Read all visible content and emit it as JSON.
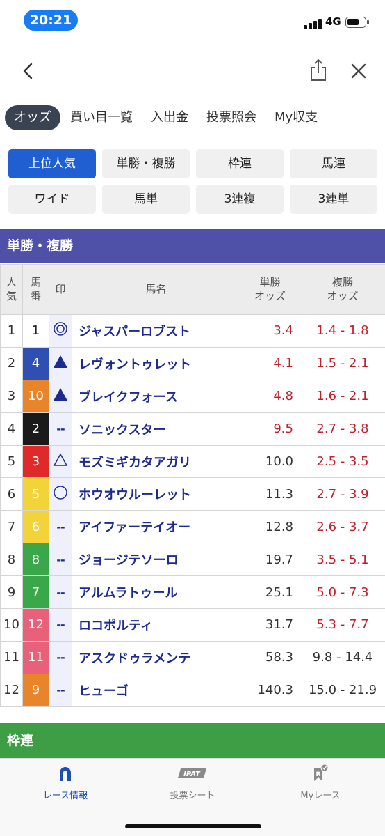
{
  "status": {
    "time": "20:21",
    "network": "4G"
  },
  "tabs": [
    "オッズ",
    "買い目一覧",
    "入出金",
    "投票照会",
    "My収支"
  ],
  "bet_types": [
    "上位人気",
    "単勝・複勝",
    "枠連",
    "馬連",
    "ワイド",
    "馬単",
    "3連複",
    "3連単"
  ],
  "section_title": "単勝・複勝",
  "table": {
    "headers": {
      "rank": [
        "人",
        "気"
      ],
      "number": [
        "馬",
        "番"
      ],
      "mark": "印",
      "name": "馬名",
      "win": [
        "単勝",
        "オッズ"
      ],
      "place": [
        "複勝",
        "オッズ"
      ]
    },
    "rows": [
      {
        "rank": "1",
        "num": "1",
        "frame_color": "#ffffff",
        "num_color": "#222222",
        "mark": "double-circle",
        "name": "ジャスパーロブスト",
        "win": "3.4",
        "win_highlight": true,
        "place": "1.4 - 1.8",
        "place_highlight": true
      },
      {
        "rank": "2",
        "num": "4",
        "frame_color": "#2f4fb3",
        "num_color": "#ffffff",
        "mark": "filled-triangle",
        "name": "レヴォントゥレット",
        "win": "4.1",
        "win_highlight": true,
        "place": "1.5 - 2.1",
        "place_highlight": true
      },
      {
        "rank": "3",
        "num": "10",
        "frame_color": "#e8842a",
        "num_color": "#ffffff",
        "mark": "filled-triangle",
        "name": "ブレイクフォース",
        "win": "4.8",
        "win_highlight": true,
        "place": "1.6 - 2.1",
        "place_highlight": true
      },
      {
        "rank": "4",
        "num": "2",
        "frame_color": "#1a1a1a",
        "num_color": "#ffffff",
        "mark": "dash",
        "name": "ソニックスター",
        "win": "9.5",
        "win_highlight": true,
        "place": "2.7 - 3.8",
        "place_highlight": true
      },
      {
        "rank": "5",
        "num": "3",
        "frame_color": "#e02a2a",
        "num_color": "#ffffff",
        "mark": "open-triangle",
        "name": "モズミギカタアガリ",
        "win": "10.0",
        "win_highlight": false,
        "place": "2.5 - 3.5",
        "place_highlight": true
      },
      {
        "rank": "6",
        "num": "5",
        "frame_color": "#f2d43a",
        "num_color": "#ffffff",
        "mark": "circle",
        "name": "ホウオウルーレット",
        "win": "11.3",
        "win_highlight": false,
        "place": "2.7 - 3.9",
        "place_highlight": true
      },
      {
        "rank": "7",
        "num": "6",
        "frame_color": "#f2d43a",
        "num_color": "#ffffff",
        "mark": "dash",
        "name": "アイファーテイオー",
        "win": "12.8",
        "win_highlight": false,
        "place": "2.6 - 3.7",
        "place_highlight": true
      },
      {
        "rank": "8",
        "num": "8",
        "frame_color": "#3aa74a",
        "num_color": "#ffffff",
        "mark": "dash",
        "name": "ジョージテソーロ",
        "win": "19.7",
        "win_highlight": false,
        "place": "3.5 - 5.1",
        "place_highlight": true
      },
      {
        "rank": "9",
        "num": "7",
        "frame_color": "#3aa74a",
        "num_color": "#ffffff",
        "mark": "dash",
        "name": "アルムラトゥール",
        "win": "25.1",
        "win_highlight": false,
        "place": "5.0 - 7.3",
        "place_highlight": true
      },
      {
        "rank": "10",
        "num": "12",
        "frame_color": "#e8607a",
        "num_color": "#ffffff",
        "mark": "dash",
        "name": "ロコポルティ",
        "win": "31.7",
        "win_highlight": false,
        "place": "5.3 - 7.7",
        "place_highlight": true
      },
      {
        "rank": "11",
        "num": "11",
        "frame_color": "#e8607a",
        "num_color": "#ffffff",
        "mark": "dash",
        "name": "アスクドゥラメンテ",
        "win": "58.3",
        "win_highlight": false,
        "place": "9.8 - 14.4",
        "place_highlight": false
      },
      {
        "rank": "12",
        "num": "9",
        "frame_color": "#e8842a",
        "num_color": "#ffffff",
        "mark": "dash",
        "name": "ヒューゴ",
        "win": "140.3",
        "win_highlight": false,
        "place": "15.0 - 21.9",
        "place_highlight": false
      }
    ]
  },
  "next_section_title": "枠連",
  "bottom_nav": [
    {
      "label": "レース情報",
      "icon": "horseshoe-icon",
      "active": true
    },
    {
      "label": "投票シート",
      "icon": "ipat-icon",
      "badge": "IPAT",
      "active": false
    },
    {
      "label": "Myレース",
      "icon": "my-race-icon",
      "badge": "R",
      "active": false
    }
  ],
  "colors": {
    "accent": "#1f5fd1",
    "section_win": "#4f51a8",
    "section_waku": "#3e9e45",
    "odds_red": "#c0202a"
  }
}
